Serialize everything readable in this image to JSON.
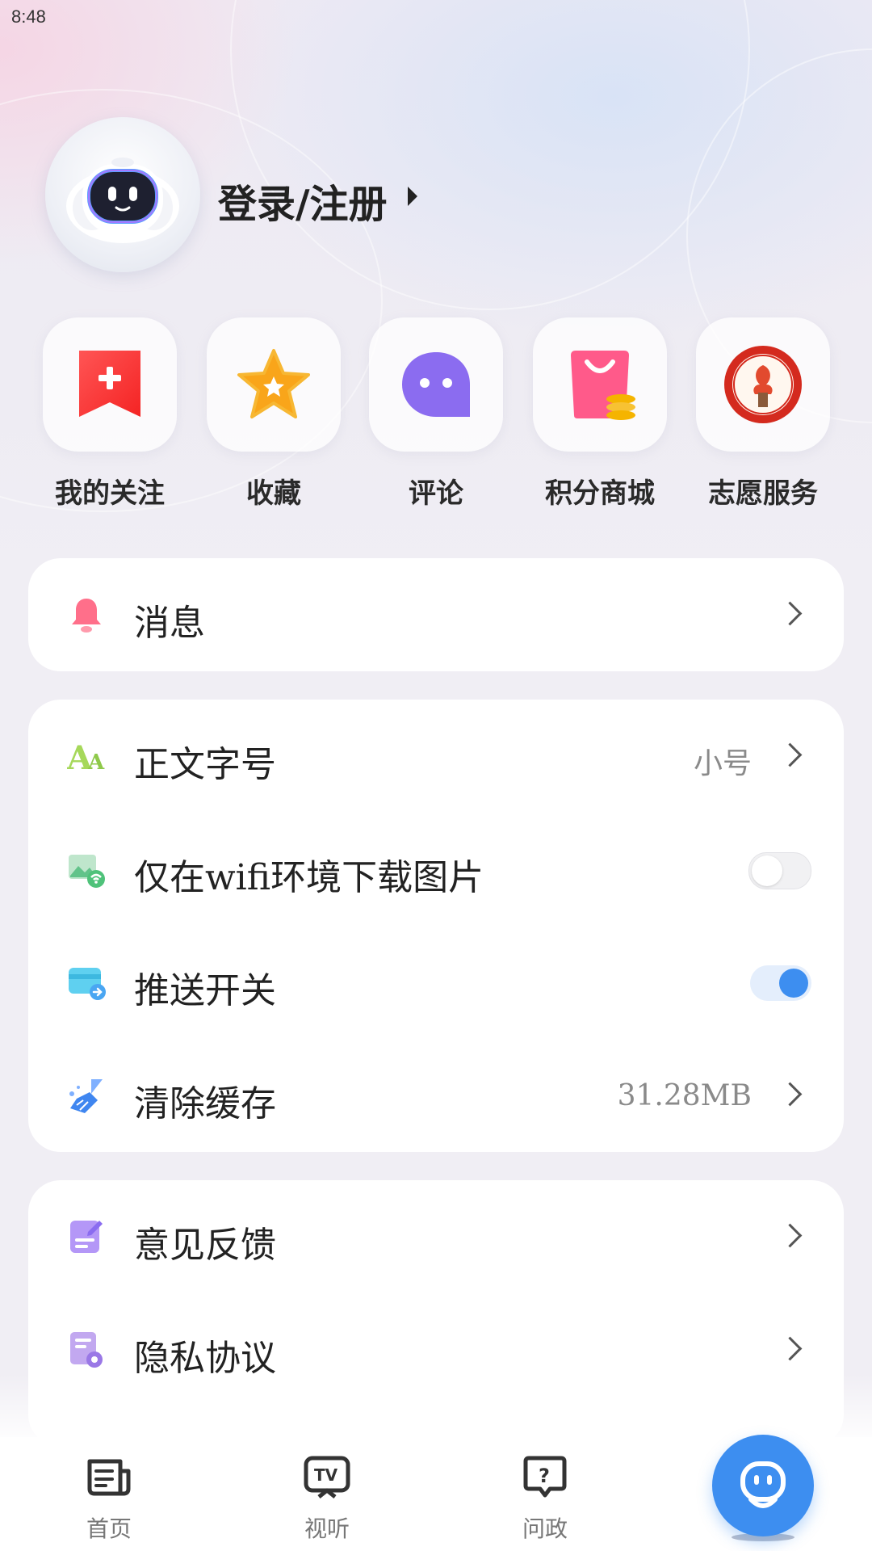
{
  "status_bar": {
    "time": "8:48"
  },
  "profile": {
    "login_label": "登录/注册"
  },
  "shortcuts": [
    {
      "label": "我的关注",
      "icon": "bookmark-plus-icon"
    },
    {
      "label": "收藏",
      "icon": "star-icon"
    },
    {
      "label": "评论",
      "icon": "chat-bubble-icon"
    },
    {
      "label": "积分商城",
      "icon": "shopping-bag-icon"
    },
    {
      "label": "志愿服务",
      "icon": "volunteer-badge-icon"
    }
  ],
  "messages": {
    "label": "消息",
    "icon": "bell-icon"
  },
  "settings": {
    "font_size": {
      "label": "正文字号",
      "value": "小号",
      "icon": "font-size-icon"
    },
    "wifi_images": {
      "label": "仅在wifi环境下载图片",
      "enabled": false,
      "icon": "wifi-image-icon"
    },
    "push": {
      "label": "推送开关",
      "enabled": true,
      "icon": "push-card-icon"
    },
    "clear_cache": {
      "label": "清除缓存",
      "value": "31.28MB",
      "icon": "broom-icon"
    }
  },
  "more": {
    "feedback": {
      "label": "意见反馈",
      "icon": "feedback-icon"
    },
    "privacy": {
      "label": "隐私协议",
      "icon": "privacy-doc-icon"
    }
  },
  "tabbar": {
    "items": [
      {
        "label": "首页",
        "icon": "news-icon"
      },
      {
        "label": "视听",
        "icon": "tv-icon"
      },
      {
        "label": "问政",
        "icon": "question-bubble-icon"
      }
    ],
    "active_icon": "robot-icon"
  },
  "colors": {
    "accent": "#3d8ef0",
    "text": "#222222",
    "muted": "#8a8a8a"
  }
}
